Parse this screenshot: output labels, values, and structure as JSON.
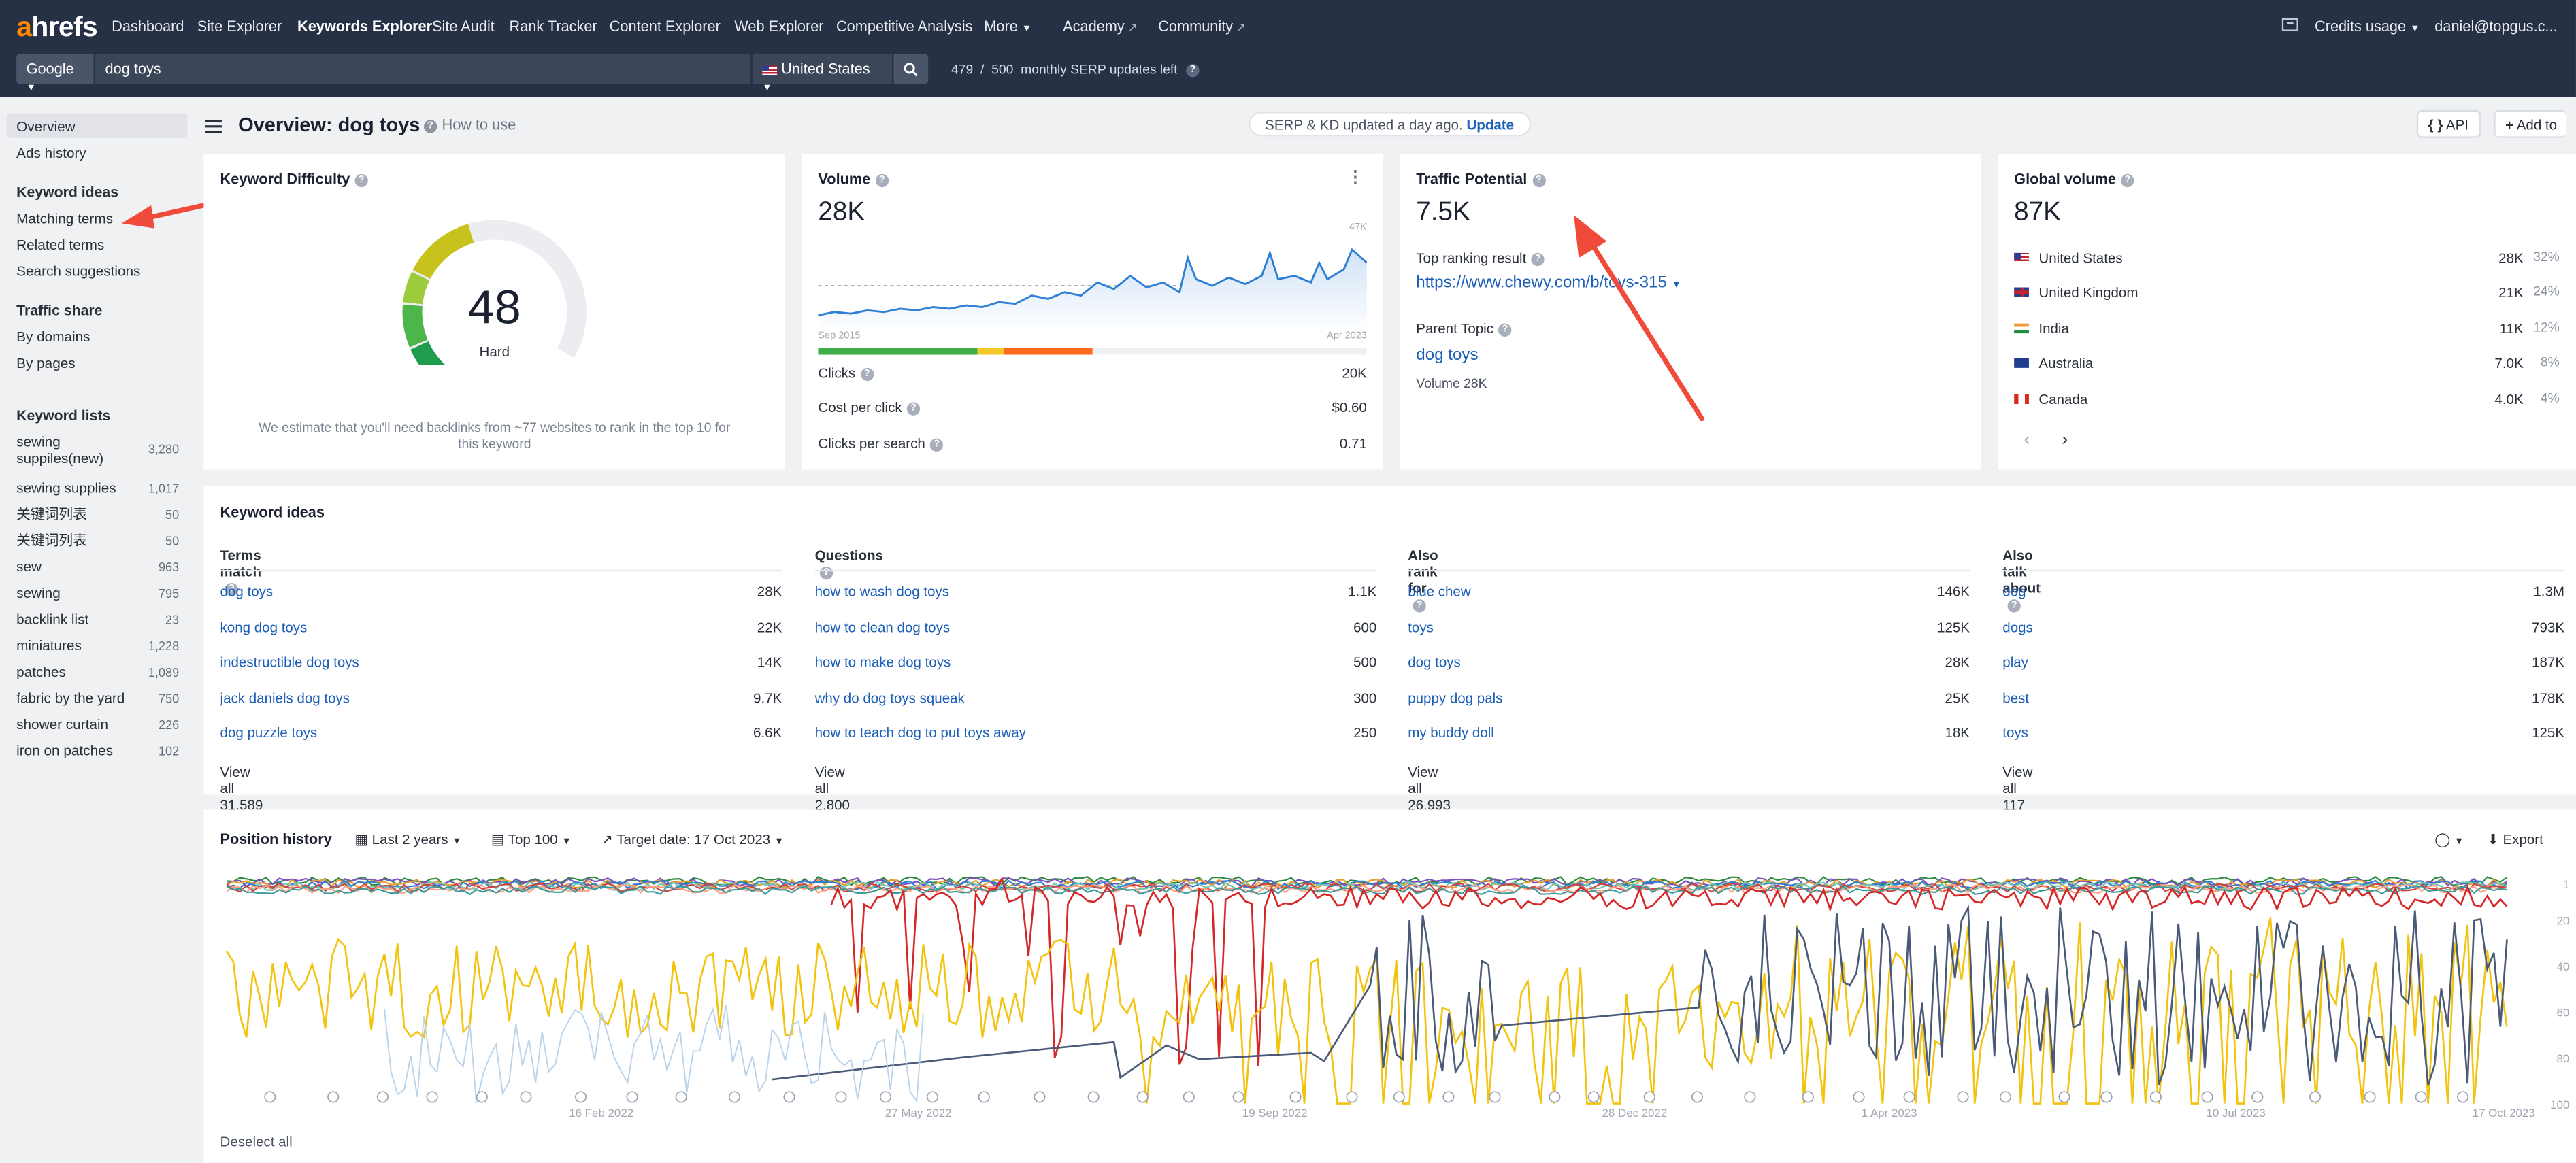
{
  "topbar": {
    "logo_a": "a",
    "logo_rest": "hrefs",
    "nav": [
      "Dashboard",
      "Site Explorer",
      "Keywords Explorer",
      "Site Audit",
      "Rank Tracker",
      "Content Explorer",
      "Web Explorer",
      "Competitive Analysis",
      "More",
      "Academy",
      "Community"
    ],
    "credits": "Credits usage",
    "user": "daniel@topgus.c...",
    "engine": "Google",
    "query": "dog toys",
    "country": "United States",
    "serp_used": "479",
    "serp_sep": "/",
    "serp_total": "500",
    "serp_text": "monthly SERP updates left"
  },
  "sidebar": {
    "overview": "Overview",
    "ads_history": "Ads history",
    "keyword_ideas_h": "Keyword ideas",
    "matching_terms": "Matching terms",
    "related_terms": "Related terms",
    "search_suggestions": "Search suggestions",
    "traffic_share_h": "Traffic share",
    "by_domains": "By domains",
    "by_pages": "By pages",
    "keyword_lists_h": "Keyword lists",
    "lists": [
      {
        "name": "sewing suppiles(new)",
        "count": "3,280"
      },
      {
        "name": "sewing supplies",
        "count": "1,017"
      },
      {
        "name": "关键词列表",
        "count": "50"
      },
      {
        "name": "关键词列表",
        "count": "50"
      },
      {
        "name": "sew",
        "count": "963"
      },
      {
        "name": "sewing",
        "count": "795"
      },
      {
        "name": "backlink list",
        "count": "23"
      },
      {
        "name": "miniatures",
        "count": "1,228"
      },
      {
        "name": "patches",
        "count": "1,089"
      },
      {
        "name": "fabric by the yard",
        "count": "750"
      },
      {
        "name": "shower curtain",
        "count": "226"
      },
      {
        "name": "iron on patches",
        "count": "102"
      }
    ]
  },
  "header": {
    "title": "Overview: dog toys",
    "how_to": "How to use",
    "serp_notice": "SERP & KD updated a day ago.",
    "update": "Update",
    "api": "API",
    "add_to": "Add to"
  },
  "kd": {
    "title": "Keyword Difficulty",
    "value": "48",
    "label": "Hard",
    "score": 48,
    "note": "We estimate that you'll need backlinks from ~77 websites to rank in the top 10 for this keyword"
  },
  "volume": {
    "title": "Volume",
    "value": "28K",
    "max_label": "47K",
    "start_label": "Sep 2015",
    "end_label": "Apr 2023",
    "clicks_label": "Clicks",
    "clicks": "20K",
    "cpc_label": "Cost per click",
    "cpc": "$0.60",
    "cps_label": "Clicks per search",
    "cps": "0.71"
  },
  "traffic": {
    "title": "Traffic Potential",
    "value": "7.5K",
    "top_label": "Top ranking result",
    "top_url": "https://www.chewy.com/b/toys-315",
    "parent_label": "Parent Topic",
    "parent": "dog toys",
    "parent_volume": "Volume 28K"
  },
  "global": {
    "title": "Global volume",
    "value": "87K",
    "countries": [
      {
        "name": "United States",
        "value": "28K",
        "pct": "32%"
      },
      {
        "name": "United Kingdom",
        "value": "21K",
        "pct": "24%"
      },
      {
        "name": "India",
        "value": "11K",
        "pct": "12%"
      },
      {
        "name": "Australia",
        "value": "7.0K",
        "pct": "8%"
      },
      {
        "name": "Canada",
        "value": "4.0K",
        "pct": "4%"
      }
    ]
  },
  "ideas": {
    "title": "Keyword ideas",
    "columns": [
      {
        "header": "Terms match",
        "rows": [
          [
            "dog toys",
            "28K"
          ],
          [
            "kong dog toys",
            "22K"
          ],
          [
            "indestructible dog toys",
            "14K"
          ],
          [
            "jack daniels dog toys",
            "9.7K"
          ],
          [
            "dog puzzle toys",
            "6.6K"
          ]
        ],
        "view_all": "View all 31,589"
      },
      {
        "header": "Questions",
        "rows": [
          [
            "how to wash dog toys",
            "1.1K"
          ],
          [
            "how to clean dog toys",
            "600"
          ],
          [
            "how to make dog toys",
            "500"
          ],
          [
            "why do dog toys squeak",
            "300"
          ],
          [
            "how to teach dog to put toys away",
            "250"
          ]
        ],
        "view_all": "View all 2,800"
      },
      {
        "header": "Also rank for",
        "rows": [
          [
            "blue chew",
            "146K"
          ],
          [
            "toys",
            "125K"
          ],
          [
            "dog toys",
            "28K"
          ],
          [
            "puppy dog pals",
            "25K"
          ],
          [
            "my buddy doll",
            "18K"
          ]
        ],
        "view_all": "View all 26,993"
      },
      {
        "header": "Also talk about",
        "rows": [
          [
            "dog",
            "1.3M"
          ],
          [
            "dogs",
            "793K"
          ],
          [
            "play",
            "187K"
          ],
          [
            "best",
            "178K"
          ],
          [
            "toys",
            "125K"
          ]
        ],
        "view_all": "View all 117"
      }
    ]
  },
  "position": {
    "title": "Position history",
    "range": "Last 2 years",
    "top": "Top 100",
    "target": "Target date: 17 Oct 2023",
    "export": "Export",
    "deselect": "Deselect all",
    "x_labels": [
      "16 Feb 2022",
      "27 May 2022",
      "19 Sep 2022",
      "28 Dec 2022",
      "1 Apr 2023",
      "10 Jul 2023",
      "17 Oct 2023"
    ],
    "y_labels": [
      "1",
      "20",
      "40",
      "60",
      "80",
      "100"
    ]
  },
  "colors": {
    "topbar": "#273145",
    "link": "#1c5fb8",
    "accent": "#ff8800",
    "annotation": "#f04b3a"
  }
}
